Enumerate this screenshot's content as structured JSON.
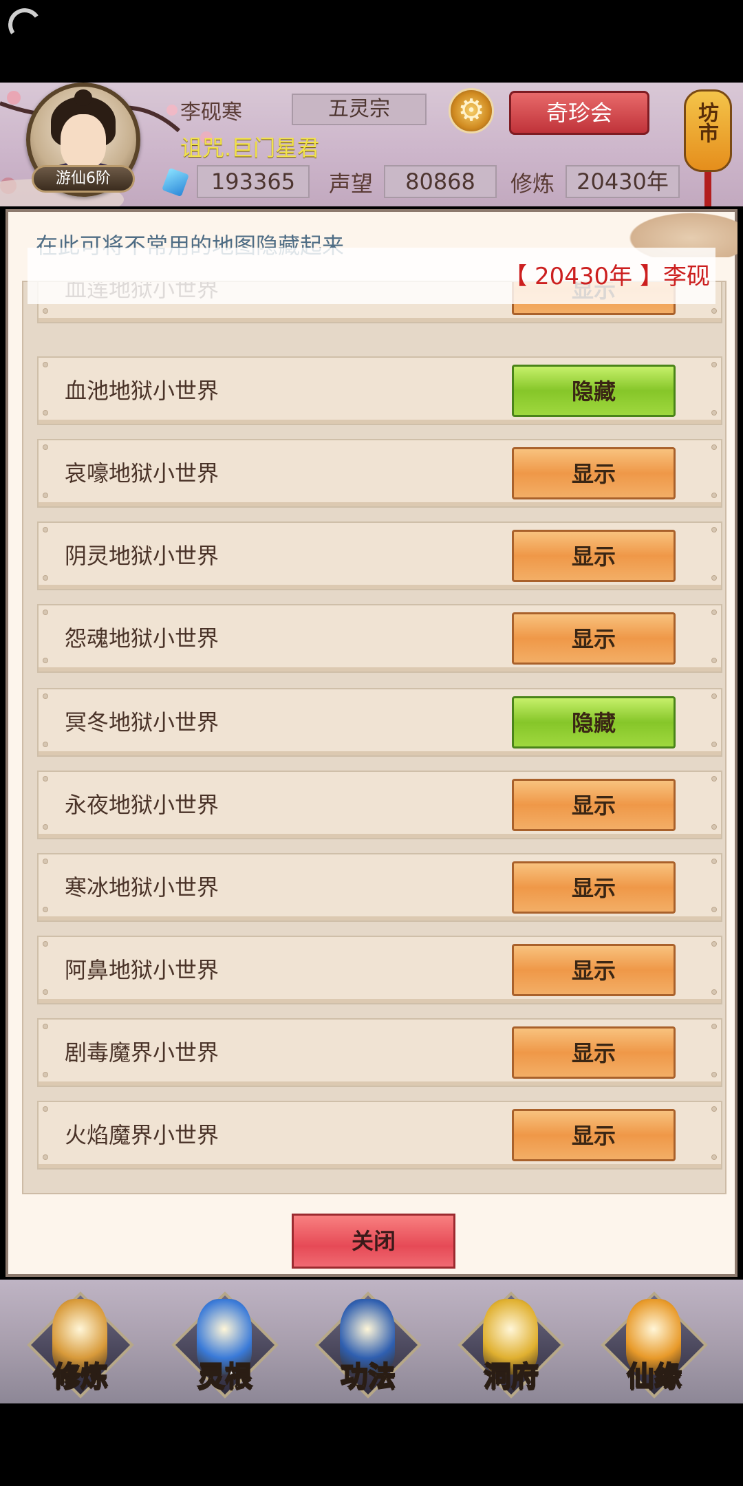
{
  "header": {
    "player_name": "李砚寒",
    "sect": "五灵宗",
    "treasure_button": "奇珍会",
    "title": "诅咒.巨门星君",
    "rank": "游仙6阶",
    "market": "坊市",
    "spirit_stones": "193365",
    "reputation_label": "声望",
    "reputation": "80868",
    "cultivation_label": "修炼",
    "cultivation": "20430年"
  },
  "panel": {
    "hint": "在此可将不常用的地图隐藏起来",
    "notice": "【 20430年 】李砚",
    "close_button": "关闭",
    "rows": [
      {
        "name": "血莲地狱小世界",
        "action": "显示",
        "state": "show"
      },
      {
        "name": "血池地狱小世界",
        "action": "隐藏",
        "state": "hide"
      },
      {
        "name": "哀嚎地狱小世界",
        "action": "显示",
        "state": "show"
      },
      {
        "name": "阴灵地狱小世界",
        "action": "显示",
        "state": "show"
      },
      {
        "name": "怨魂地狱小世界",
        "action": "显示",
        "state": "show"
      },
      {
        "name": "冥冬地狱小世界",
        "action": "隐藏",
        "state": "hide"
      },
      {
        "name": "永夜地狱小世界",
        "action": "显示",
        "state": "show"
      },
      {
        "name": "寒冰地狱小世界",
        "action": "显示",
        "state": "show"
      },
      {
        "name": "阿鼻地狱小世界",
        "action": "显示",
        "state": "show"
      },
      {
        "name": "剧毒魔界小世界",
        "action": "显示",
        "state": "show"
      },
      {
        "name": "火焰魔界小世界",
        "action": "显示",
        "state": "show"
      }
    ]
  },
  "nav": {
    "items": [
      {
        "label": "修炼",
        "icon": "cultivation-icon",
        "color": "#d89a3a"
      },
      {
        "label": "灵根",
        "icon": "spirit-root-icon",
        "color": "#3a7ad8"
      },
      {
        "label": "功法",
        "icon": "technique-icon",
        "color": "#2f5fb0"
      },
      {
        "label": "洞府",
        "icon": "cave-abode-icon",
        "color": "#e0b030"
      },
      {
        "label": "仙缘",
        "icon": "immortal-fate-icon",
        "color": "#e89a2a"
      }
    ]
  }
}
